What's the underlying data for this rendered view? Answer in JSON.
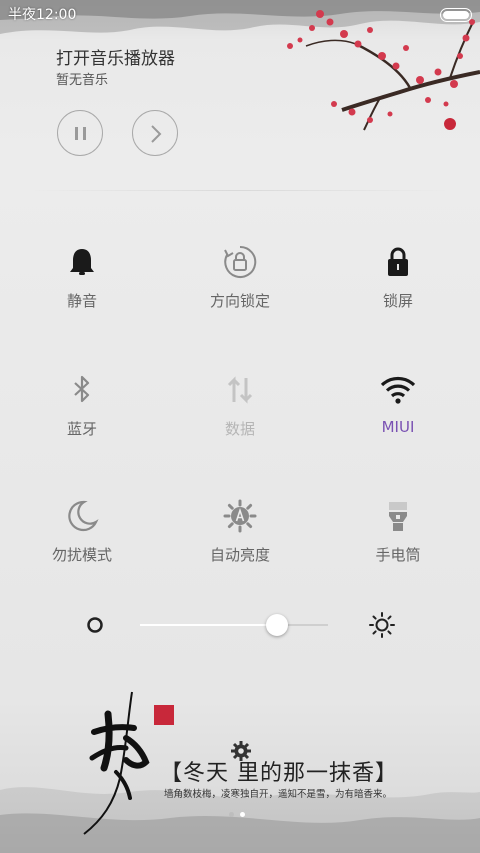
{
  "status_bar": {
    "time": "半夜12:00"
  },
  "music": {
    "title": "打开音乐播放器",
    "subtitle": "暂无音乐",
    "controls": [
      "pause",
      "next"
    ]
  },
  "toggles": [
    {
      "label": "静音",
      "icon": "bell-icon",
      "state": "on"
    },
    {
      "label": "方向锁定",
      "icon": "rotation-lock-icon",
      "state": "off"
    },
    {
      "label": "锁屏",
      "icon": "lock-icon",
      "state": "on"
    },
    {
      "label": "蓝牙",
      "icon": "bluetooth-icon",
      "state": "off"
    },
    {
      "label": "数据",
      "icon": "data-arrows-icon",
      "state": "disabled"
    },
    {
      "label": "MIUI",
      "icon": "wifi-icon",
      "state": "connected"
    },
    {
      "label": "勿扰模式",
      "icon": "moon-icon",
      "state": "off"
    },
    {
      "label": "自动亮度",
      "icon": "auto-brightness-icon",
      "state": "off"
    },
    {
      "label": "手电筒",
      "icon": "flashlight-icon",
      "state": "off"
    }
  ],
  "brightness": {
    "level": 0.73
  },
  "poem": {
    "title": "【冬天  里的那一抹香】",
    "line": "墙角数枝梅，凌寒独自开，遥知不是雪，为有暗香来。"
  },
  "pager": {
    "count": 2,
    "current": 1
  },
  "colors": {
    "active_label": "#7a52b3",
    "icon_dark": "#1a1a1a",
    "icon_gray": "#8a8a8a",
    "icon_disabled": "#c4c4c4",
    "plum_red": "#c8283a"
  }
}
